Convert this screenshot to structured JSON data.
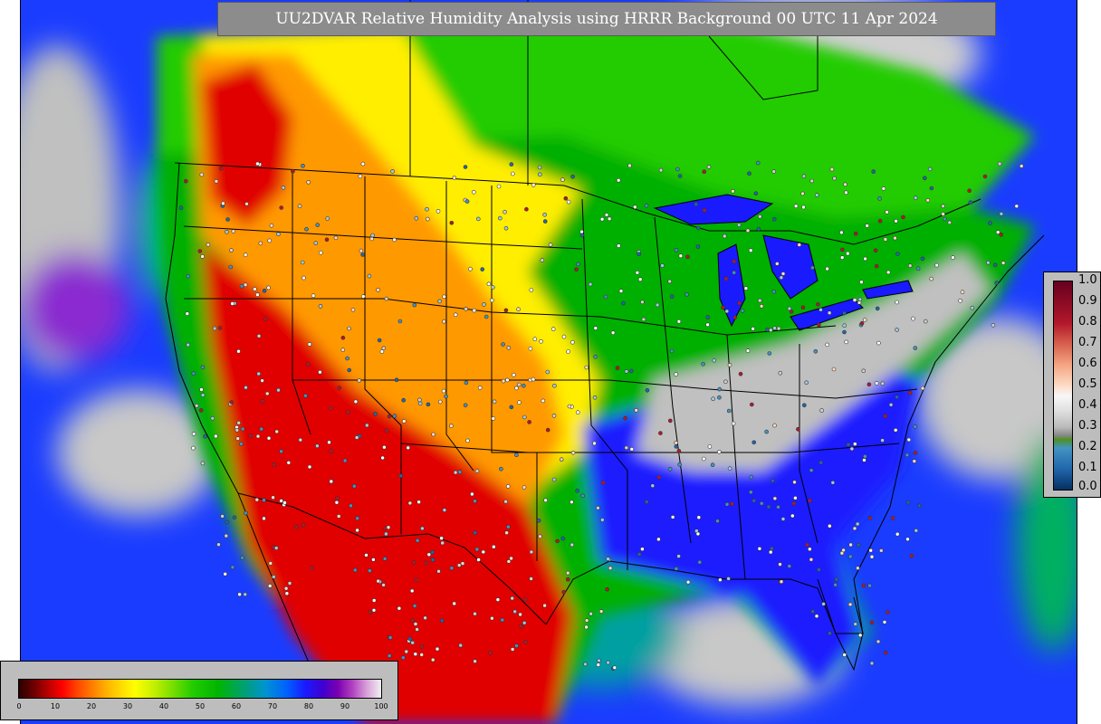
{
  "title": "UU2DVAR Relative Humidity Analysis using HRRR Background 00 UTC 11 Apr 2024",
  "colors": {
    "title_bg": "#8c8c8c",
    "legend_bg": "#bdbdbd",
    "ocean_moist": "#c8c8c8",
    "very_dry": "#e00000",
    "dry": "#ff9900",
    "moderate": "#ffee00",
    "moist": "#22cc00",
    "wet": "#1a1aff",
    "saturated": "#c0c0c0"
  },
  "rh_legend": {
    "ticks": [
      "0",
      "10",
      "20",
      "30",
      "40",
      "50",
      "60",
      "70",
      "80",
      "90",
      "100"
    ]
  },
  "increment_legend": {
    "ticks": [
      "1.0",
      "0.9",
      "0.8",
      "0.7",
      "0.6",
      "0.5",
      "0.4",
      "0.3",
      "0.2",
      "0.1",
      "0.0"
    ]
  },
  "map": {
    "projection": "lambert-conformal",
    "coverage": "CONUS",
    "observation_markers": "station-dot-icon"
  }
}
